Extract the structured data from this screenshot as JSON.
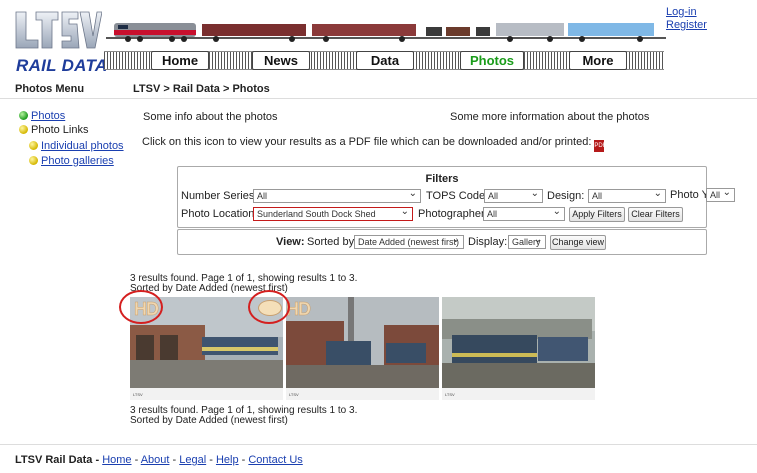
{
  "header": {
    "logo_text": "LTSV",
    "logo_sub": "RAIL DATA",
    "nav": [
      "Home",
      "News",
      "Data",
      "Photos",
      "More"
    ],
    "active_nav": "Photos",
    "login": "Log-in",
    "register": "Register"
  },
  "menu": {
    "title": "Photos Menu",
    "items": [
      {
        "label": "Photos",
        "bullet": "green"
      },
      {
        "label": "Photo Links",
        "bullet": "yellow"
      },
      {
        "label": "Individual photos",
        "bullet": "yellow"
      },
      {
        "label": "Photo galleries",
        "bullet": "yellow"
      }
    ]
  },
  "breadcrumb": "LTSV > Rail Data > Photos",
  "info": {
    "left": "Some info about the photos",
    "right": "Some more information about the photos",
    "pdf_text": "Click on this icon to view your results as a PDF file which can be downloaded and/or printed:"
  },
  "filters": {
    "title": "Filters",
    "number_series_label": "Number Series:",
    "number_series_value": "All",
    "tops_label": "TOPS Code:",
    "tops_value": "All",
    "design_label": "Design:",
    "design_value": "All",
    "year_label": "Photo Year:",
    "year_value": "All",
    "location_label": "Photo Location:",
    "location_value": "Sunderland South Dock Shed",
    "photographer_label": "Photographer:",
    "photographer_value": "All",
    "apply": "Apply Filters",
    "clear": "Clear Filters"
  },
  "view": {
    "label": "View:",
    "sorted_label": "Sorted by:",
    "sorted_value": "Date Added (newest first)",
    "display_label": "Display:",
    "display_value": "Gallery",
    "change": "Change view"
  },
  "results": {
    "line1": "3 results found. Page 1 of 1, showing results 1 to 3.",
    "line2": "Sorted by Date Added (newest first)"
  },
  "thumbs": [
    {
      "badge": "HD"
    },
    {
      "badge": "HD"
    },
    {
      "badge": ""
    }
  ],
  "footer": {
    "brand": "LTSV Rail Data - ",
    "links": [
      "Home",
      "About",
      "Legal",
      "Help",
      "Contact Us"
    ],
    "sep": " - "
  },
  "colors": {
    "link": "#1a3fb0",
    "active_nav": "#1a9c1a",
    "logo_blue": "#1f3d9b",
    "highlight_ring": "#d41f1f"
  }
}
